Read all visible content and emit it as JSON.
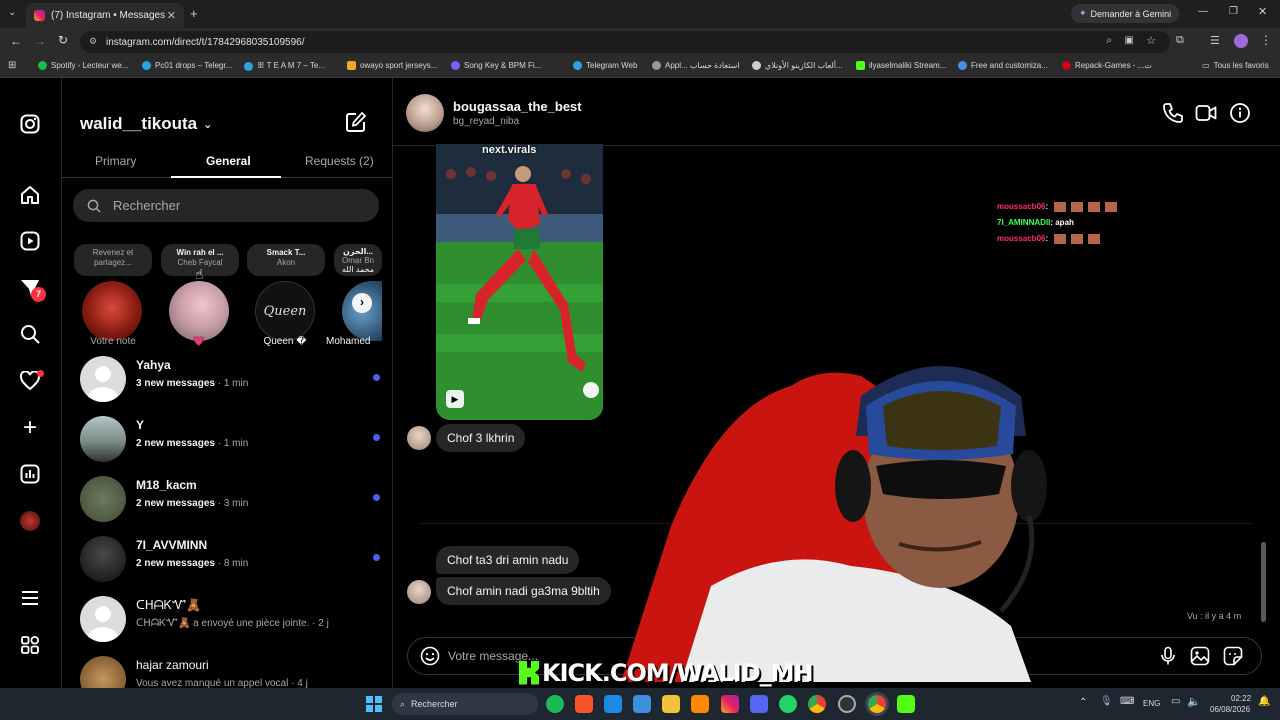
{
  "browser": {
    "tab_title": "(7) Instagram • Messages",
    "url": "instagram.com/direct/t/17842968035109596/",
    "gemini_label": "Demander à Gemini",
    "bookmarks": [
      "Spotify - Lecteur we...",
      "Pc01 drops – Telegr...",
      "ꕥ T E A M 7 – Te...",
      "owayo sport jerseys...",
      "Song Key & BPM Fi...",
      "Telegram Web",
      "Appl... استعادة حساب",
      "ألعاب الكازينو الأونلاي...",
      "ilyaselmaliki Stream...",
      "Free and customiza...",
      "Repack-Games - ...ت"
    ],
    "all_bookmarks": "Tous les favoris"
  },
  "rail": {
    "notifications_badge": "7"
  },
  "inbox": {
    "username": "walid__tikouta",
    "tabs": [
      "Primary",
      "General",
      "Requests (2)"
    ],
    "search_placeholder": "Rechercher",
    "notes": [
      {
        "note": "Revenez et partagez...",
        "label": "Votre note"
      },
      {
        "note": "Win rah el ...",
        "sub": "Cheb Faycal",
        "label": "💗"
      },
      {
        "note": "Smack T...",
        "sub": "Akon",
        "label": "Queen �"
      },
      {
        "note": "الحزن...",
        "sub": "Omar Bn",
        "sub2": "محمد الله",
        "label": "Mohamed"
      }
    ],
    "conversations": [
      {
        "name": "Yahya",
        "bold": "3 new messages",
        "time": " · 1 min"
      },
      {
        "name": "Y",
        "bold": "2 new messages",
        "time": " · 1 min"
      },
      {
        "name": "M18_kacm",
        "bold": "2 new messages",
        "time": " · 3 min"
      },
      {
        "name": "7I_AVVMINN",
        "bold": "2 new messages",
        "time": " · 8 min"
      },
      {
        "name": "ᑕᕼᗩᏦᏉ🧸",
        "plain": "ᑕᕼᗩᏦᏉ🧸 a envoyé une pièce jointe.",
        "time": " · 2 j"
      },
      {
        "name": "hajar zamouri",
        "plain": "Vous avez manqué un appel vocal",
        "time": " · 4 j"
      }
    ]
  },
  "chat": {
    "contact_name": "bougassaa_the_best",
    "contact_handle": "bg_reyad_niba",
    "reel_account": "next.virals",
    "messages": [
      "Chof 3 lkhrin",
      "Chof ta3 dri amin nadu",
      "Chof amin nadi ga3ma 9bltih"
    ],
    "seen": "Vu : il y a 4 m",
    "input_placeholder": "Votre message..."
  },
  "overlay": {
    "chat_lines": [
      {
        "user": "moussacb06",
        "text": ": "
      },
      {
        "user": "7I_AMINNADII",
        "text": ": apah"
      },
      {
        "user": "moussacb06",
        "text": ": "
      }
    ],
    "kick_banner": "KICK.COM/WALID_MH"
  },
  "taskbar": {
    "search": "Rechercher",
    "lang": "ENG",
    "time": "02:22",
    "date": "06/08/2026"
  },
  "colors": {
    "accent": "#4d5cf5",
    "kick_green": "#53fc18",
    "overlay_pink": "#ff2d6f",
    "overlay_green": "#3cff5a"
  }
}
